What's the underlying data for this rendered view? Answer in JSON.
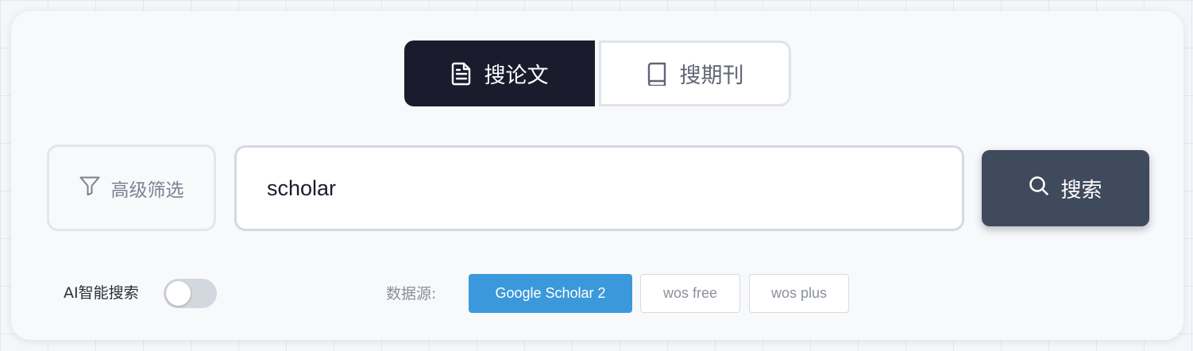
{
  "mode_tabs": [
    {
      "label": "搜论文",
      "icon": "document-icon",
      "active": true
    },
    {
      "label": "搜期刊",
      "icon": "book-icon",
      "active": false
    }
  ],
  "filter": {
    "label": "高级筛选",
    "icon": "filter-icon"
  },
  "search": {
    "value": "scholar",
    "placeholder": ""
  },
  "search_button": {
    "label": "搜索",
    "icon": "search-icon"
  },
  "ai_search": {
    "label": "AI智能搜索",
    "enabled": false
  },
  "data_source": {
    "label": "数据源:",
    "options": [
      {
        "label": "Google Scholar 2",
        "selected": true
      },
      {
        "label": "wos free",
        "selected": false
      },
      {
        "label": "wos plus",
        "selected": false
      }
    ]
  },
  "colors": {
    "active_tab": "#1a1c2e",
    "search_button": "#3f4a5c",
    "selected_chip": "#3b99db"
  }
}
